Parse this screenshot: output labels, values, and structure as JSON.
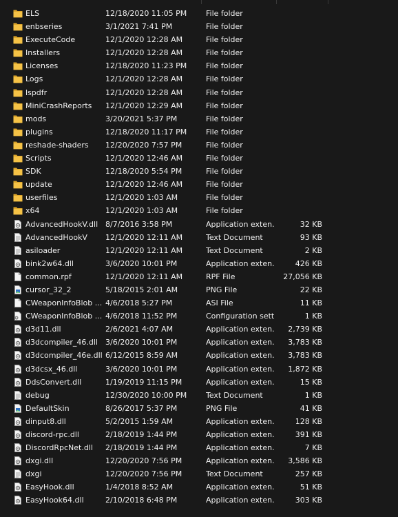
{
  "files": [
    {
      "name": "ELS",
      "date": "12/18/2020 11:05 PM",
      "type": "File folder",
      "size": "",
      "icon": "folder-icon"
    },
    {
      "name": "enbseries",
      "date": "3/1/2021 7:41 PM",
      "type": "File folder",
      "size": "",
      "icon": "folder-icon"
    },
    {
      "name": "ExecuteCode",
      "date": "12/1/2020 12:28 AM",
      "type": "File folder",
      "size": "",
      "icon": "folder-icon"
    },
    {
      "name": "Installers",
      "date": "12/1/2020 12:28 AM",
      "type": "File folder",
      "size": "",
      "icon": "folder-icon"
    },
    {
      "name": "Licenses",
      "date": "12/18/2020 11:23 PM",
      "type": "File folder",
      "size": "",
      "icon": "folder-icon"
    },
    {
      "name": "Logs",
      "date": "12/1/2020 12:28 AM",
      "type": "File folder",
      "size": "",
      "icon": "folder-icon"
    },
    {
      "name": "lspdfr",
      "date": "12/1/2020 12:28 AM",
      "type": "File folder",
      "size": "",
      "icon": "folder-icon"
    },
    {
      "name": "MiniCrashReports",
      "date": "12/1/2020 12:29 AM",
      "type": "File folder",
      "size": "",
      "icon": "folder-icon"
    },
    {
      "name": "mods",
      "date": "3/20/2021 5:37 PM",
      "type": "File folder",
      "size": "",
      "icon": "folder-icon"
    },
    {
      "name": "plugins",
      "date": "12/18/2020 11:17 PM",
      "type": "File folder",
      "size": "",
      "icon": "folder-icon"
    },
    {
      "name": "reshade-shaders",
      "date": "12/20/2020 7:57 PM",
      "type": "File folder",
      "size": "",
      "icon": "folder-icon"
    },
    {
      "name": "Scripts",
      "date": "12/1/2020 12:46 AM",
      "type": "File folder",
      "size": "",
      "icon": "folder-icon"
    },
    {
      "name": "SDK",
      "date": "12/18/2020 5:54 PM",
      "type": "File folder",
      "size": "",
      "icon": "folder-icon"
    },
    {
      "name": "update",
      "date": "12/1/2020 12:46 AM",
      "type": "File folder",
      "size": "",
      "icon": "folder-icon"
    },
    {
      "name": "userfiles",
      "date": "12/1/2020 1:03 AM",
      "type": "File folder",
      "size": "",
      "icon": "folder-icon"
    },
    {
      "name": "x64",
      "date": "12/1/2020 1:03 AM",
      "type": "File folder",
      "size": "",
      "icon": "folder-icon"
    },
    {
      "name": "AdvancedHookV.dll",
      "date": "8/7/2016 3:58 PM",
      "type": "Application exten...",
      "size": "32 KB",
      "icon": "dll-icon"
    },
    {
      "name": "AdvancedHookV",
      "date": "12/1/2020 12:11 AM",
      "type": "Text Document",
      "size": "93 KB",
      "icon": "text-document-icon"
    },
    {
      "name": "asiloader",
      "date": "12/1/2020 12:11 AM",
      "type": "Text Document",
      "size": "2 KB",
      "icon": "text-document-icon"
    },
    {
      "name": "bink2w64.dll",
      "date": "3/6/2020 10:01 PM",
      "type": "Application exten...",
      "size": "426 KB",
      "icon": "dll-icon"
    },
    {
      "name": "common.rpf",
      "date": "12/1/2020 12:11 AM",
      "type": "RPF File",
      "size": "27,056 KB",
      "icon": "blank-file-icon"
    },
    {
      "name": "cursor_32_2",
      "date": "5/18/2015 2:01 AM",
      "type": "PNG File",
      "size": "22 KB",
      "icon": "image-file-icon"
    },
    {
      "name": "CWeaponInfoBlob ...",
      "date": "4/6/2018 5:27 PM",
      "type": "ASI File",
      "size": "11 KB",
      "icon": "blank-file-icon"
    },
    {
      "name": "CWeaponInfoBlob ...",
      "date": "4/6/2018 11:52 PM",
      "type": "Configuration sett...",
      "size": "1 KB",
      "icon": "config-file-icon"
    },
    {
      "name": "d3d11.dll",
      "date": "2/6/2021 4:07 AM",
      "type": "Application exten...",
      "size": "2,739 KB",
      "icon": "dll-icon"
    },
    {
      "name": "d3dcompiler_46.dll",
      "date": "3/6/2020 10:01 PM",
      "type": "Application exten...",
      "size": "3,783 KB",
      "icon": "dll-icon"
    },
    {
      "name": "d3dcompiler_46e.dll",
      "date": "6/12/2015 8:59 AM",
      "type": "Application exten...",
      "size": "3,783 KB",
      "icon": "dll-icon"
    },
    {
      "name": "d3dcsx_46.dll",
      "date": "3/6/2020 10:01 PM",
      "type": "Application exten...",
      "size": "1,872 KB",
      "icon": "dll-icon"
    },
    {
      "name": "DdsConvert.dll",
      "date": "1/19/2019 11:15 PM",
      "type": "Application exten...",
      "size": "15 KB",
      "icon": "dll-icon"
    },
    {
      "name": "debug",
      "date": "12/30/2020 10:00 PM",
      "type": "Text Document",
      "size": "1 KB",
      "icon": "text-document-icon"
    },
    {
      "name": "DefaultSkin",
      "date": "8/26/2017 5:37 PM",
      "type": "PNG File",
      "size": "41 KB",
      "icon": "image-file-icon"
    },
    {
      "name": "dinput8.dll",
      "date": "5/2/2015 1:59 AM",
      "type": "Application exten...",
      "size": "128 KB",
      "icon": "dll-icon"
    },
    {
      "name": "discord-rpc.dll",
      "date": "2/18/2019 1:44 PM",
      "type": "Application exten...",
      "size": "391 KB",
      "icon": "dll-icon"
    },
    {
      "name": "DiscordRpcNet.dll",
      "date": "2/18/2019 1:44 PM",
      "type": "Application exten...",
      "size": "7 KB",
      "icon": "dll-icon"
    },
    {
      "name": "dxgi.dll",
      "date": "12/20/2020 7:56 PM",
      "type": "Application exten...",
      "size": "3,586 KB",
      "icon": "dll-icon"
    },
    {
      "name": "dxgi",
      "date": "12/20/2020 7:56 PM",
      "type": "Text Document",
      "size": "257 KB",
      "icon": "text-document-icon"
    },
    {
      "name": "EasyHook.dll",
      "date": "1/4/2018 8:52 AM",
      "type": "Application exten...",
      "size": "51 KB",
      "icon": "dll-icon"
    },
    {
      "name": "EasyHook64.dll",
      "date": "2/10/2018 6:48 PM",
      "type": "Application exten...",
      "size": "303 KB",
      "icon": "dll-icon"
    }
  ],
  "colors": {
    "background": "#191919",
    "text": "#f0f0f0",
    "folder": "#f5c246",
    "folder_dark": "#dca52a"
  }
}
